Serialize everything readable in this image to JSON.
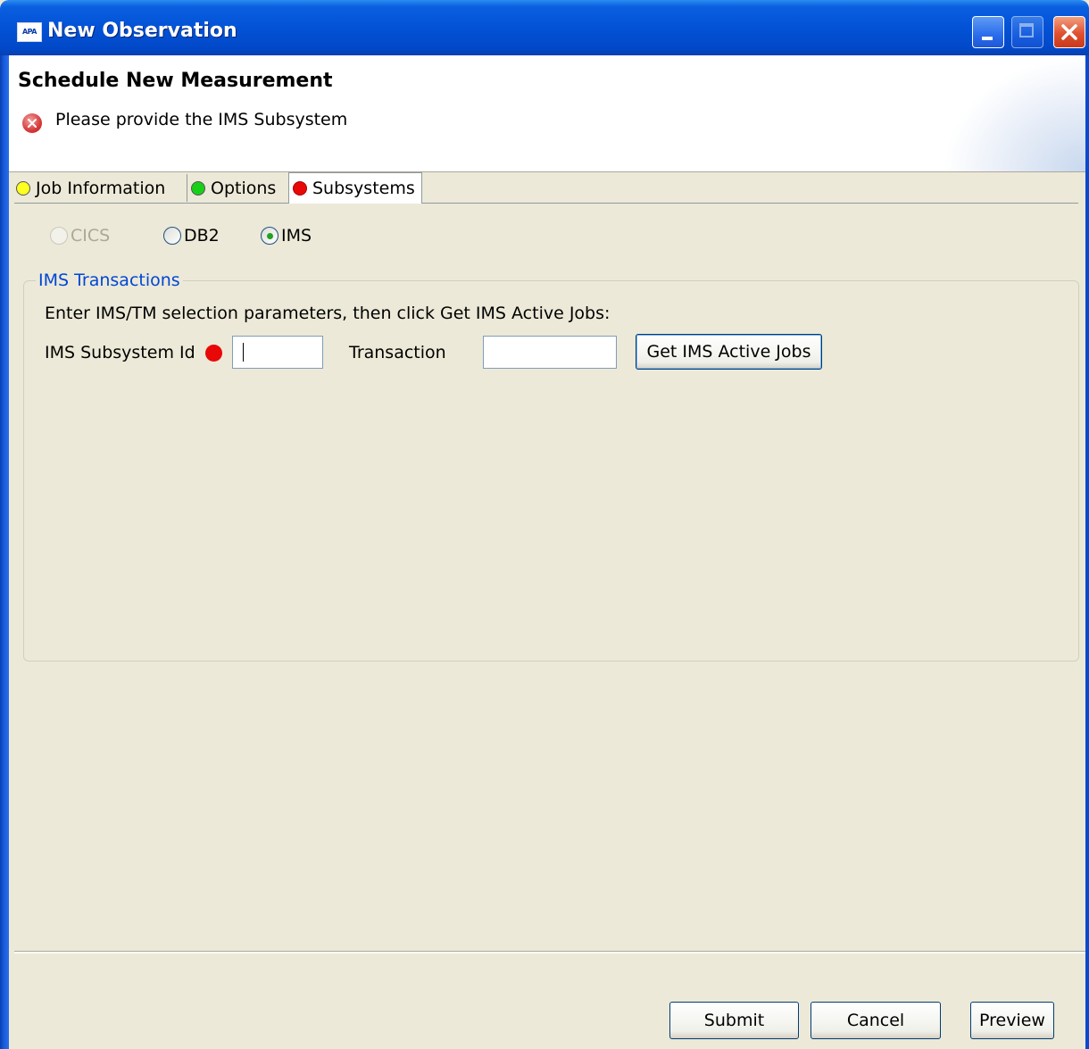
{
  "window": {
    "title": "New Observation",
    "app_icon_text": "APA"
  },
  "header": {
    "title": "Schedule New Measurement",
    "error_message": "Please provide the IMS Subsystem",
    "error_icon": "error-x-icon"
  },
  "tabs": [
    {
      "label": "Job Information",
      "status": "yellow",
      "color": "#ffff20"
    },
    {
      "label": "Options",
      "status": "green",
      "color": "#18d018"
    },
    {
      "label": "Subsystems",
      "status": "red",
      "color": "#e80808",
      "selected": true
    }
  ],
  "subsystem_radios": [
    {
      "label": "CICS",
      "enabled": false,
      "selected": false
    },
    {
      "label": "DB2",
      "enabled": true,
      "selected": false
    },
    {
      "label": "IMS",
      "enabled": true,
      "selected": true
    }
  ],
  "ims_group": {
    "legend": "IMS Transactions",
    "instructions": "Enter IMS/TM selection parameters, then click Get IMS Active Jobs:",
    "subsystem_label": "IMS Subsystem Id",
    "subsystem_value": "",
    "transaction_label": "Transaction",
    "transaction_value": "",
    "get_jobs_button": "Get IMS Active Jobs"
  },
  "buttons": {
    "submit": "Submit",
    "cancel": "Cancel",
    "preview": "Preview"
  }
}
